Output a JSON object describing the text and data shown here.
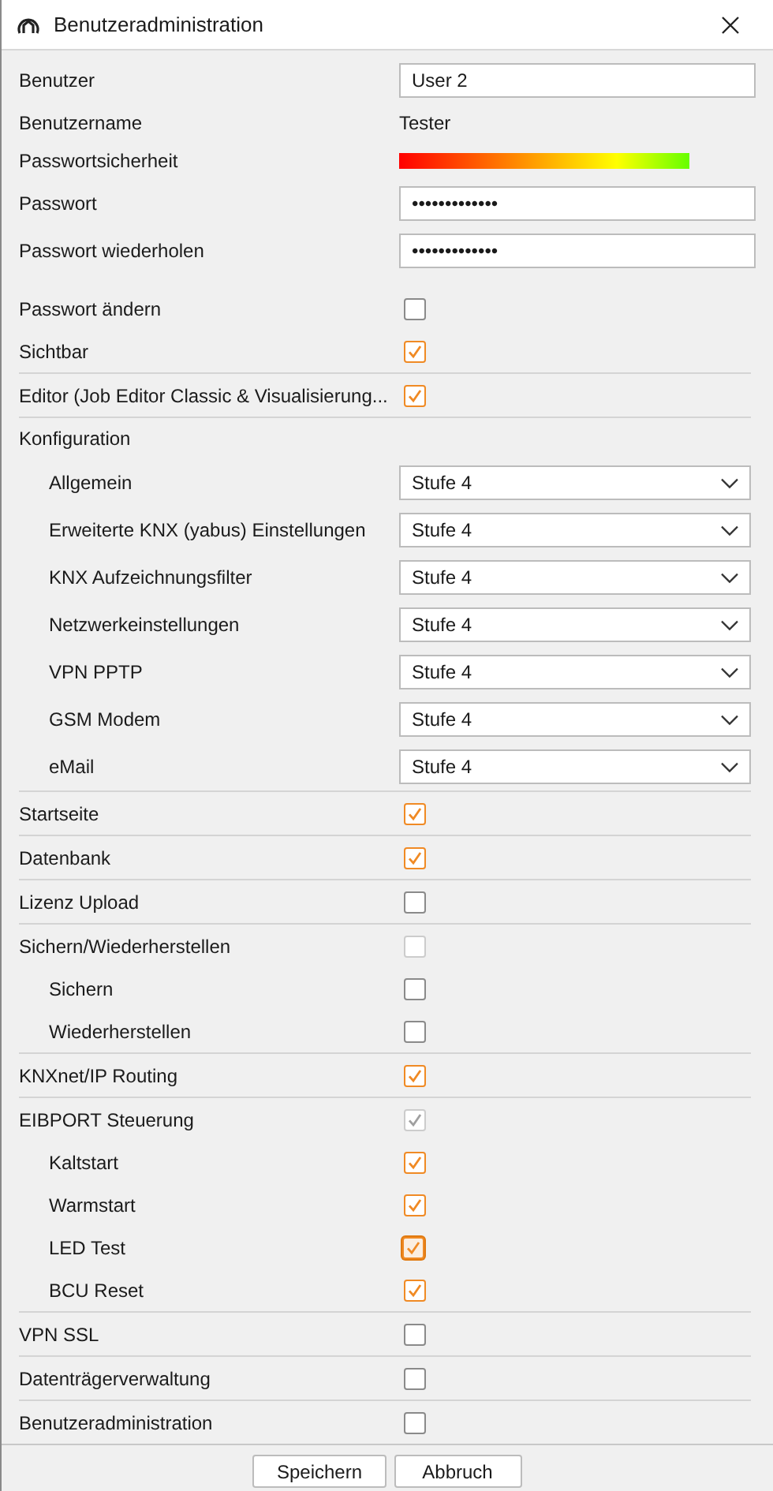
{
  "window": {
    "title": "Benutzeradministration"
  },
  "account": [
    {
      "kind": "input",
      "label": "Benutzer",
      "value": "User 2"
    },
    {
      "kind": "text",
      "label": "Benutzername",
      "value": "Tester"
    },
    {
      "kind": "meter",
      "label": "Passwortsicherheit"
    },
    {
      "kind": "password",
      "label": "Passwort",
      "value": "•••••••••••••"
    },
    {
      "kind": "password",
      "label": "Passwort wiederholen",
      "value": "•••••••••••••"
    }
  ],
  "options": [
    {
      "label": "Passwort ändern",
      "checked": false
    },
    {
      "label": "Sichtbar",
      "checked": true
    }
  ],
  "permissions": [
    {
      "kind": "checkbox",
      "label": "Editor (Job Editor Classic & Visualisierung...",
      "checked": true,
      "disabled": false,
      "focused": false
    },
    {
      "kind": "group",
      "label": "Konfiguration",
      "children": [
        {
          "kind": "select",
          "label": "Allgemein",
          "value": "Stufe 4"
        },
        {
          "kind": "select",
          "label": "Erweiterte KNX (yabus) Einstellungen",
          "value": "Stufe 4"
        },
        {
          "kind": "select",
          "label": "KNX Aufzeichnungsfilter",
          "value": "Stufe 4"
        },
        {
          "kind": "select",
          "label": "Netzwerkeinstellungen",
          "value": "Stufe 4"
        },
        {
          "kind": "select",
          "label": "VPN PPTP",
          "value": "Stufe 4"
        },
        {
          "kind": "select",
          "label": "GSM Modem",
          "value": "Stufe 4"
        },
        {
          "kind": "select",
          "label": "eMail",
          "value": "Stufe 4"
        }
      ]
    },
    {
      "kind": "checkbox",
      "label": "Startseite",
      "checked": true,
      "disabled": false,
      "focused": false
    },
    {
      "kind": "checkbox",
      "label": "Datenbank",
      "checked": true,
      "disabled": false,
      "focused": false
    },
    {
      "kind": "checkbox",
      "label": "Lizenz Upload",
      "checked": false,
      "disabled": false,
      "focused": false
    },
    {
      "kind": "checkbox",
      "label": "Sichern/Wiederherstellen",
      "checked": false,
      "disabled": true,
      "focused": false,
      "children": [
        {
          "kind": "checkbox",
          "label": "Sichern",
          "checked": false,
          "disabled": false,
          "focused": false
        },
        {
          "kind": "checkbox",
          "label": "Wiederherstellen",
          "checked": false,
          "disabled": false,
          "focused": false
        }
      ]
    },
    {
      "kind": "checkbox",
      "label": "KNXnet/IP Routing",
      "checked": true,
      "disabled": false,
      "focused": false
    },
    {
      "kind": "checkbox",
      "label": "EIBPORT Steuerung",
      "checked": true,
      "disabled": true,
      "focused": false,
      "children": [
        {
          "kind": "checkbox",
          "label": "Kaltstart",
          "checked": true,
          "disabled": false,
          "focused": false
        },
        {
          "kind": "checkbox",
          "label": "Warmstart",
          "checked": true,
          "disabled": false,
          "focused": false
        },
        {
          "kind": "checkbox",
          "label": "LED Test",
          "checked": true,
          "disabled": false,
          "focused": true
        },
        {
          "kind": "checkbox",
          "label": "BCU Reset",
          "checked": true,
          "disabled": false,
          "focused": false
        }
      ]
    },
    {
      "kind": "checkbox",
      "label": "VPN SSL",
      "checked": false,
      "disabled": false,
      "focused": false
    },
    {
      "kind": "checkbox",
      "label": "Datenträgerverwaltung",
      "checked": false,
      "disabled": false,
      "focused": false
    },
    {
      "kind": "checkbox",
      "label": "Benutzeradministration",
      "checked": false,
      "disabled": false,
      "focused": false
    }
  ],
  "buttons": [
    "Speichern",
    "Abbruch"
  ]
}
